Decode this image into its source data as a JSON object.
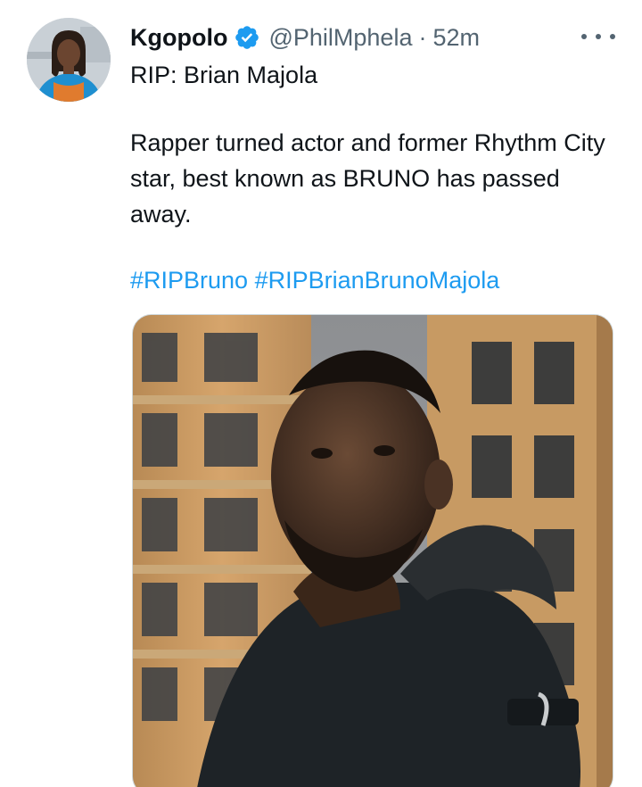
{
  "tweet": {
    "author": {
      "display_name": "Kgopolo",
      "handle": "@PhilMphela",
      "verified": true,
      "avatar_icon": "profile-photo"
    },
    "separator": "·",
    "timestamp": "52m",
    "more_icon": "more-horizontal-icon",
    "text": {
      "line1": "RIP: Brian Majola",
      "line2": "Rapper turned actor and former Rhythm City star, best known as BRUNO has passed away.",
      "hashtags": [
        "#RIPBruno",
        "#RIPBrianBrunoMajola"
      ]
    },
    "media": {
      "type": "photo"
    },
    "colors": {
      "link": "#1d9bf0",
      "verified_badge": "#1d9bf0",
      "secondary_text": "#536471",
      "primary_text": "#0f1419"
    }
  }
}
